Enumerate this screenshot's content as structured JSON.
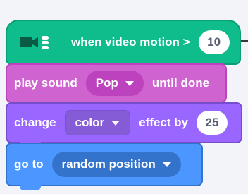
{
  "hat_block": {
    "icon": "video-sensing-icon",
    "label": "when video motion >",
    "value": "10",
    "color": "#0fbd8c"
  },
  "sound_block": {
    "prefix": "play sound",
    "dropdown": "Pop",
    "suffix": "until done",
    "color": "#cf63cf"
  },
  "looks_block": {
    "prefix": "change",
    "dropdown": "color",
    "middle": "effect by",
    "value": "25",
    "color": "#9966ff"
  },
  "motion_block": {
    "prefix": "go to",
    "dropdown": "random position",
    "color": "#4c97ff"
  }
}
